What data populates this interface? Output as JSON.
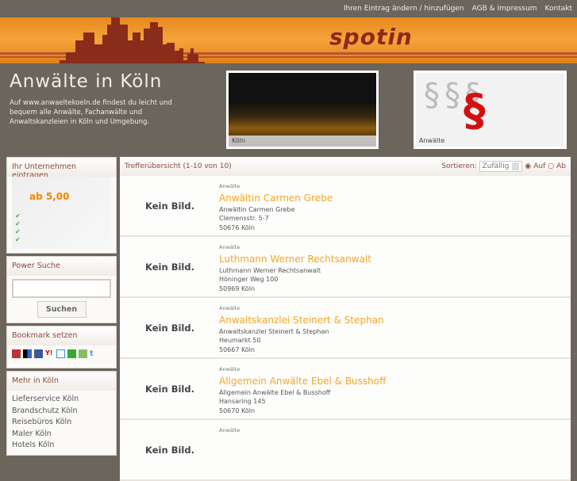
{
  "nav": [
    "Ihren Eintrag ändern / hinzufügen",
    "AGB & Impressum",
    "Kontakt"
  ],
  "logo": "spotin",
  "intro": {
    "title": "Anwälte in Köln",
    "text": "Auf www.anwaeltekoeln.de findest du leicht und bequem alle Anwälte, Fachanwälte und Anwaltskanzleien in Köln und Umgebung."
  },
  "pictures": [
    {
      "caption": "Köln"
    },
    {
      "caption": "Anwälte"
    }
  ],
  "sidebar": {
    "register_title": "Ihr Unternehmen eintragen",
    "promo_price": "ab 5,00",
    "search_title": "Power Suche",
    "search_value": "",
    "search_button": "Suchen",
    "bookmark_title": "Bookmark setzen",
    "more_title": "Mehr in Köln",
    "more_links": [
      "Lieferservice Köln",
      "Brandschutz Köln",
      "Reisebüros Köln",
      "Maler Köln",
      "Hotels Köln"
    ]
  },
  "results": {
    "summary": "Trefferübersicht (1-10 von 10)",
    "sort_label": "Sortieren:",
    "sort_value": "Zufällig",
    "asc": "Auf",
    "desc": "Ab",
    "no_image": "Kein Bild.",
    "items": [
      {
        "category": "Anwälte",
        "name": "Anwältin Carmen Grebe",
        "line1": "Anwältin Carmen Grebe",
        "street": "Clemensstr. 5-7",
        "city": "50676 Köln"
      },
      {
        "category": "Anwälte",
        "name": "Luthmann Werner Rechtsanwalt",
        "line1": "Luthmann Werner Rechtsanwalt",
        "street": "Höninger Weg 100",
        "city": "50969 Köln"
      },
      {
        "category": "Anwälte",
        "name": "Anwaltskanzlei Steinert & Stephan",
        "line1": "Anwaltskanzlei Steinert & Stephan",
        "street": "Heumarkt 50",
        "city": "50667 Köln"
      },
      {
        "category": "Anwälte",
        "name": "Allgemein Anwälte Ebel & Busshoff",
        "line1": "Allgemein Anwälte Ebel & Busshoff",
        "street": "Hansaring 145",
        "city": "50670 Köln"
      },
      {
        "category": "Anwälte"
      }
    ]
  }
}
